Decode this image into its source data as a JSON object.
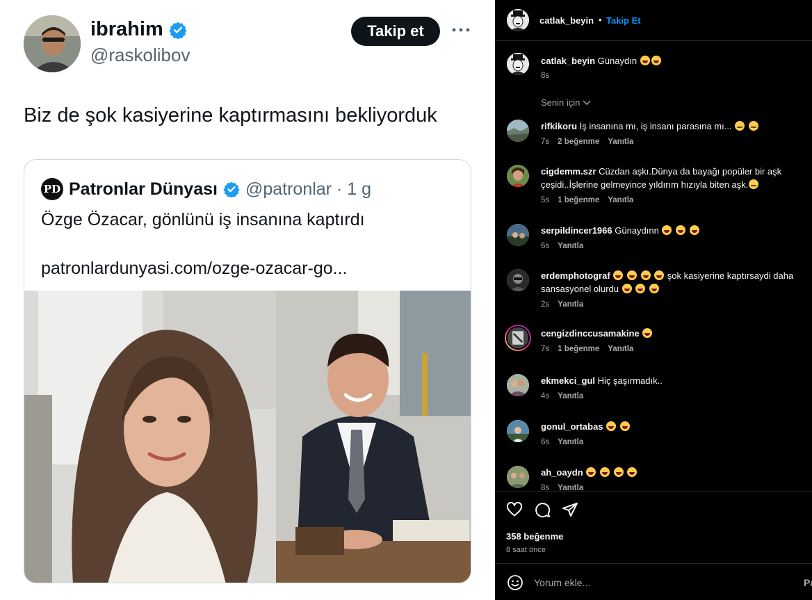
{
  "tweet": {
    "author_name": "ibrahim",
    "author_handle": "@raskolibov",
    "follow_label": "Takip et",
    "text": "Biz de şok kasiyerine kaptırmasını bekliyorduk",
    "quote": {
      "logo_text": "PD",
      "name": "Patronlar Dünyası",
      "handle_time": "@patronlar · 1 g",
      "text": "Özge Özacar, gönlünü iş insanına kaptırdı",
      "link": "patronlardunyasi.com/ozge-ozacar-go..."
    },
    "colors": {
      "verified": "#1d9bf0",
      "text": "#0f1419",
      "muted": "#536471",
      "border": "#cfd9de"
    }
  },
  "instagram": {
    "header": {
      "username": "catlak_beyin",
      "dot": "•",
      "follow_label": "Takip Et"
    },
    "caption": {
      "username": "catlak_beyin",
      "text": "Günaydın",
      "time": "8s"
    },
    "filter_label": "Senin için",
    "comments": [
      {
        "username": "rifkikoru",
        "text": "İş insanına mı, iş insanı parasına mı...",
        "time": "7s",
        "likes": "2 beğenme",
        "reply": "Yanıtla"
      },
      {
        "username": "cigdemm.szr",
        "text": "Cüzdan aşkı.Dünya da bayağı popüler bir aşk",
        "text2": "çeşidi..İşlerine gelmeyince yıldırım hızıyla biten aşk.",
        "time": "5s",
        "likes": "1 beğenme",
        "reply": "Yanıtla"
      },
      {
        "username": "serpildincer1966",
        "text": "Günaydınn",
        "time": "6s",
        "reply": "Yanıtla"
      },
      {
        "username": "erdemphotograf",
        "text": "şok kasiyerine kaptırsaydi daha",
        "text2": "sansasyonel olurdu",
        "time": "2s",
        "reply": "Yanıtla"
      },
      {
        "username": "cengizdinccusamakine",
        "text": "",
        "time": "7s",
        "likes": "1 beğenme",
        "reply": "Yanıtla"
      },
      {
        "username": "ekmekci_gul",
        "text": "Hiç şaşırmadık..",
        "time": "4s",
        "reply": "Yanıtla"
      },
      {
        "username": "gonul_ortabas",
        "text": "",
        "time": "6s",
        "reply": "Yanıtla"
      },
      {
        "username": "ah_oaydn",
        "text": "",
        "time": "8s",
        "reply": "Yanıtla"
      }
    ],
    "likes_count": "358 beğenme",
    "posted": "8 saat önce",
    "comment_placeholder": "Yorum ekle...",
    "post_label": "Paylaş",
    "colors": {
      "link": "#0095f6",
      "muted": "#a8a8a8",
      "divider": "#262626",
      "background": "#000000"
    }
  }
}
